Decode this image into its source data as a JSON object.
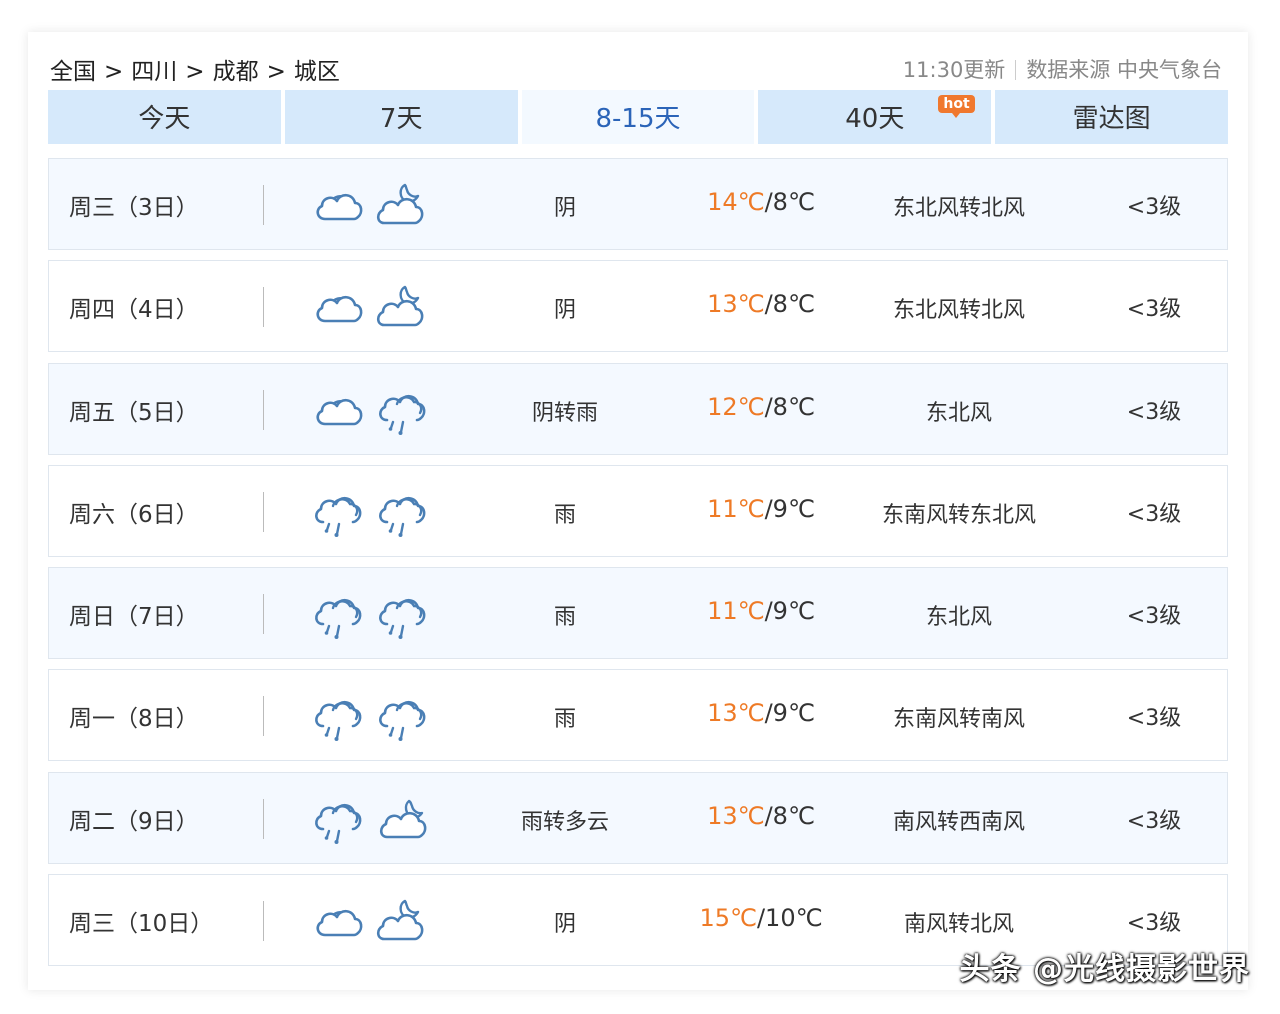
{
  "breadcrumb": {
    "items": [
      "全国",
      "四川",
      "成都",
      "城区"
    ],
    "separator": ">"
  },
  "header": {
    "update_time": "11:30更新",
    "source": "数据来源 中央气象台"
  },
  "tabs": [
    {
      "label": "今天"
    },
    {
      "label": "7天"
    },
    {
      "label": "8-15天"
    },
    {
      "label": "40天",
      "badge": "hot"
    },
    {
      "label": "雷达图"
    }
  ],
  "active_tab": 2,
  "forecast": [
    {
      "day": "周三（3日）",
      "icon_day": "cloudy-icon",
      "icon_night": "cloud-moon-icon",
      "weather": "阴",
      "high": "14℃",
      "low": "8℃",
      "wind": "东北风转北风",
      "level": "<3级"
    },
    {
      "day": "周四（4日）",
      "icon_day": "cloudy-icon",
      "icon_night": "cloud-moon-icon",
      "weather": "阴",
      "high": "13℃",
      "low": "8℃",
      "wind": "东北风转北风",
      "level": "<3级"
    },
    {
      "day": "周五（5日）",
      "icon_day": "cloudy-icon",
      "icon_night": "rain-icon",
      "weather": "阴转雨",
      "high": "12℃",
      "low": "8℃",
      "wind": "东北风",
      "level": "<3级"
    },
    {
      "day": "周六（6日）",
      "icon_day": "rain-icon",
      "icon_night": "rain-icon",
      "weather": "雨",
      "high": "11℃",
      "low": "9℃",
      "wind": "东南风转东北风",
      "level": "<3级"
    },
    {
      "day": "周日（7日）",
      "icon_day": "rain-icon",
      "icon_night": "rain-icon",
      "weather": "雨",
      "high": "11℃",
      "low": "9℃",
      "wind": "东北风",
      "level": "<3级"
    },
    {
      "day": "周一（8日）",
      "icon_day": "rain-icon",
      "icon_night": "rain-icon",
      "weather": "雨",
      "high": "13℃",
      "low": "9℃",
      "wind": "东南风转南风",
      "level": "<3级"
    },
    {
      "day": "周二（9日）",
      "icon_day": "rain-icon",
      "icon_night": "partly-cloudy-moon-icon",
      "weather": "雨转多云",
      "high": "13℃",
      "low": "8℃",
      "wind": "南风转西南风",
      "level": "<3级"
    },
    {
      "day": "周三（10日）",
      "icon_day": "cloudy-icon",
      "icon_night": "cloud-moon-icon",
      "weather": "阴",
      "high": "15℃",
      "low": "10℃",
      "wind": "南风转北风",
      "level": "<3级"
    }
  ],
  "colors": {
    "tab_bg": "#d6e9fb",
    "tab_active_text": "#2b64b8",
    "high_temp": "#ee7a26",
    "icon_stroke": "#4a7fb5",
    "hot_badge": "#f0782e"
  },
  "watermark": "头条 @光线摄影世界"
}
